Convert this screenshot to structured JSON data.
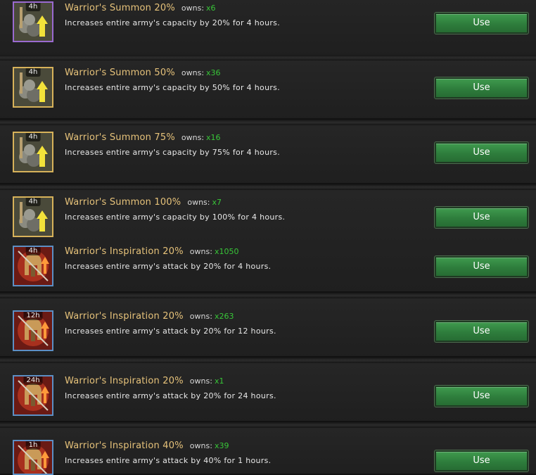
{
  "common": {
    "owns_label": "owns:",
    "use_label": "Use"
  },
  "items": [
    {
      "title": "Warrior's Summon 20%",
      "count": "x6",
      "desc": "Increases entire army's capacity by 20% for 4 hours.",
      "duration": "4h",
      "icon": "army-capacity-icon",
      "frame": "purple"
    },
    {
      "title": "Warrior's Summon 50%",
      "count": "x36",
      "desc": "Increases entire army's capacity by 50% for 4 hours.",
      "duration": "4h",
      "icon": "army-capacity-icon",
      "frame": "gold"
    },
    {
      "title": "Warrior's Summon 75%",
      "count": "x16",
      "desc": "Increases entire army's capacity by 75% for 4 hours.",
      "duration": "4h",
      "icon": "army-capacity-icon",
      "frame": "gold"
    },
    {
      "title": "Warrior's Summon 100%",
      "count": "x7",
      "desc": "Increases entire army's capacity by 100% for 4 hours.",
      "duration": "4h",
      "icon": "army-capacity-icon",
      "frame": "gold"
    },
    {
      "title": "Warrior's Inspiration 20%",
      "count": "x1050",
      "desc": "Increases entire army's attack by 20% for 4 hours.",
      "duration": "4h",
      "icon": "army-attack-icon",
      "frame": "blue"
    },
    {
      "title": "Warrior's Inspiration 20%",
      "count": "x263",
      "desc": "Increases entire army's attack by 20% for 12 hours.",
      "duration": "12h",
      "icon": "army-attack-icon",
      "frame": "blue"
    },
    {
      "title": "Warrior's Inspiration 20%",
      "count": "x1",
      "desc": "Increases entire army's attack by 20% for 24 hours.",
      "duration": "24h",
      "icon": "army-attack-icon",
      "frame": "blue"
    },
    {
      "title": "Warrior's Inspiration 40%",
      "count": "x39",
      "desc": "Increases entire army's attack by 40% for 1 hours.",
      "duration": "1h",
      "icon": "army-attack-icon",
      "frame": "blue"
    }
  ],
  "colors": {
    "title": "#e6c27a",
    "owns_count": "#38c638",
    "button": "#2e7d3c",
    "frame_purple": "#9a6ad0",
    "frame_gold": "#d7b25a",
    "frame_blue": "#5c8fc4"
  }
}
